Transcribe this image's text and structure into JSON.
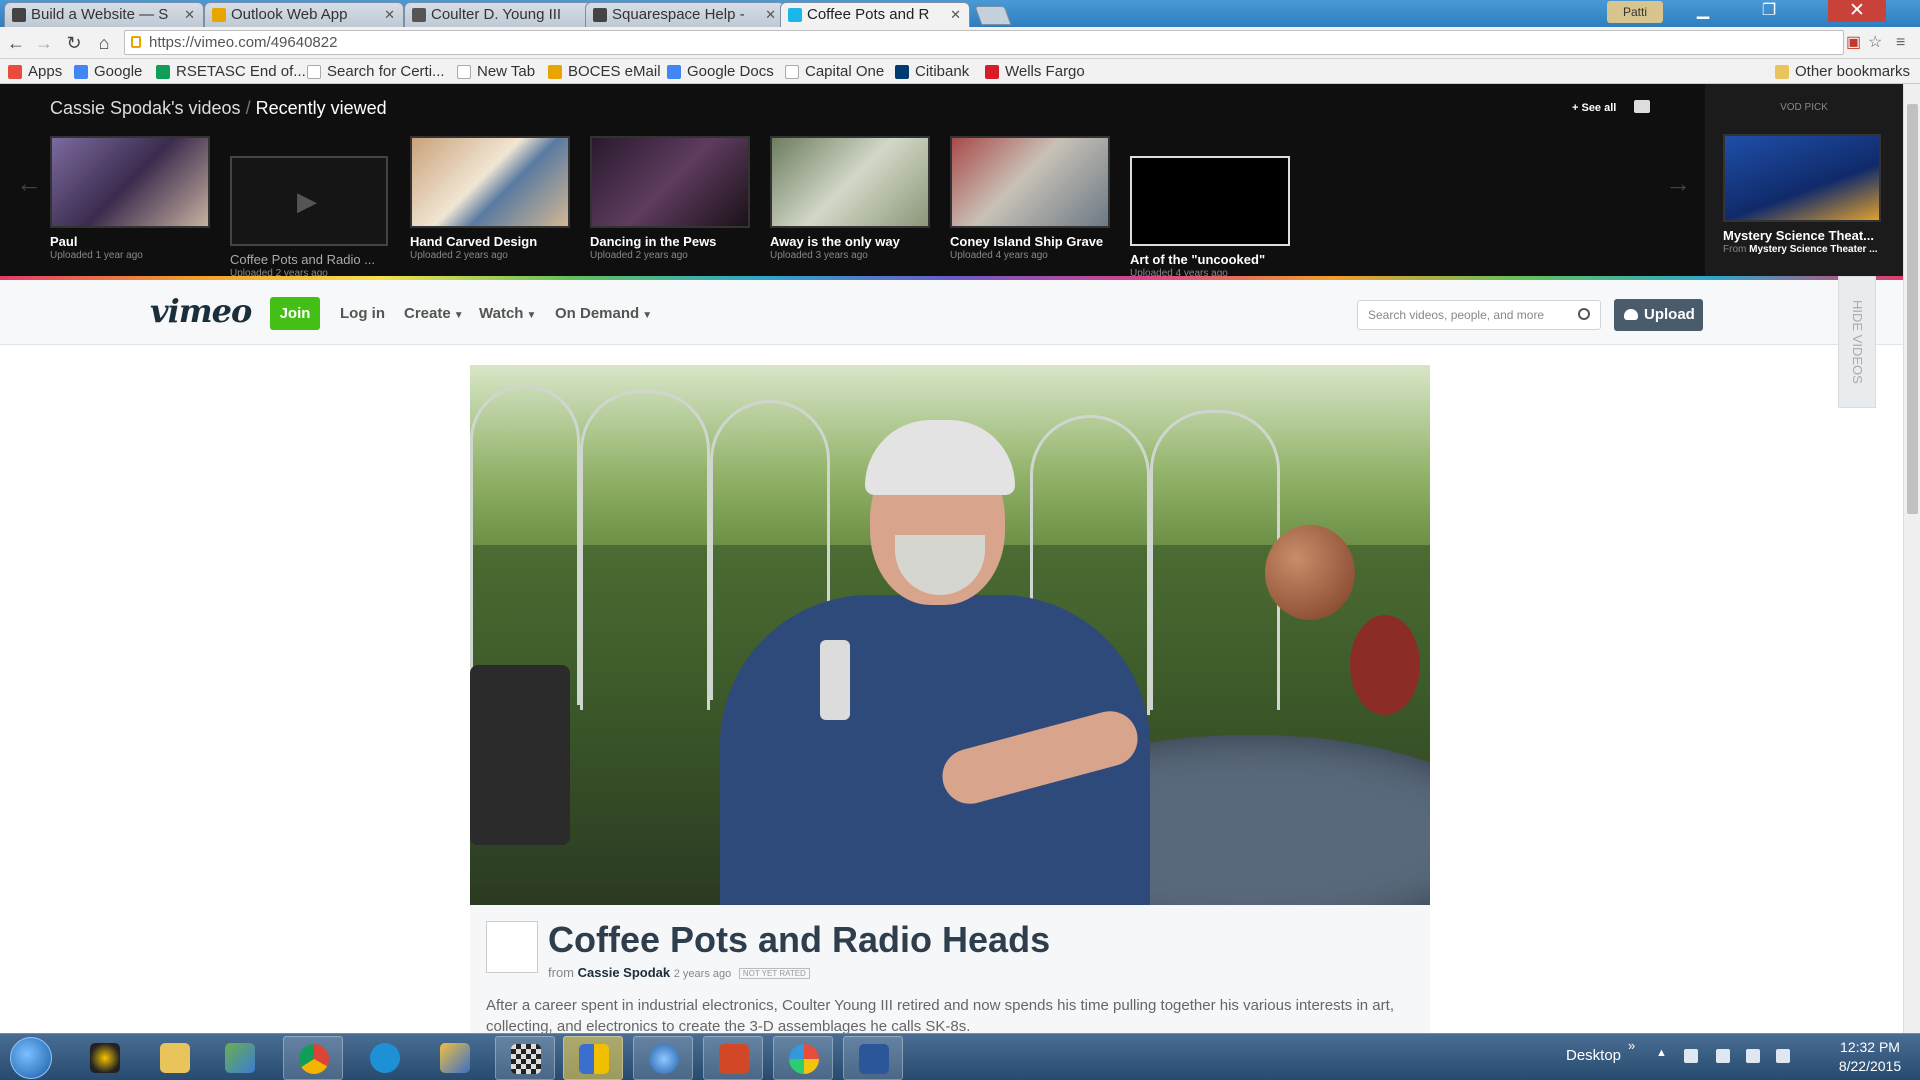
{
  "browser": {
    "tabs": [
      {
        "title": "Build a Website — S",
        "favicon_color": "#444444"
      },
      {
        "title": "Outlook Web App",
        "favicon_color": "#e7a500"
      },
      {
        "title": "Coulter D. Young III",
        "favicon_color": "#555555"
      },
      {
        "title": "Squarespace Help - ",
        "favicon_color": "#444444"
      },
      {
        "title": "Coffee Pots and R",
        "favicon_color": "#1ab7ea",
        "active": true
      }
    ],
    "profile": "Patti",
    "url": "https://vimeo.com/49640822",
    "bookmarks": [
      {
        "label": "Apps",
        "color": "#e84c3d"
      },
      {
        "label": "Google",
        "color": "#4285f4"
      },
      {
        "label": "RSETASC End of...",
        "color": "#0f9d58"
      },
      {
        "label": "Search for Certi...",
        "color": "#ffffff"
      },
      {
        "label": "New Tab",
        "color": "#ffffff"
      },
      {
        "label": "BOCES eMail",
        "color": "#e7a500"
      },
      {
        "label": "Google Docs",
        "color": "#4285f4"
      },
      {
        "label": "Capital One",
        "color": "#ffffff"
      },
      {
        "label": "Citibank",
        "color": "#003b70"
      },
      {
        "label": "Wells Fargo",
        "color": "#d71e28"
      }
    ],
    "other_bookmarks": "Other bookmarks"
  },
  "recently_viewed": {
    "owner": "Cassie Spodak's videos",
    "separator": "/",
    "heading": "Recently viewed",
    "see_all": "+ See all",
    "vod_label": "VOD PICK",
    "items": [
      {
        "title": "Paul",
        "sub": "Uploaded 1 year ago"
      },
      {
        "title": "Coffee Pots and Radio ...",
        "sub": "Uploaded 2 years ago"
      },
      {
        "title": "Hand Carved Design",
        "sub": "Uploaded 2 years ago"
      },
      {
        "title": "Dancing in the Pews",
        "sub": "Uploaded 2 years ago"
      },
      {
        "title": "Away is the only way",
        "sub": "Uploaded 3 years ago"
      },
      {
        "title": "Coney Island Ship Grave",
        "sub": "Uploaded 4 years ago"
      },
      {
        "title": "Art of the \"uncooked\"",
        "sub": "Uploaded 4 years ago"
      }
    ],
    "vod_pick": {
      "title": "Mystery Science Theat...",
      "from_prefix": "From",
      "from": "Mystery Science Theater ..."
    }
  },
  "vimeo": {
    "logo": "vimeo",
    "join": "Join",
    "nav": [
      {
        "label": "Log in",
        "dropdown": false
      },
      {
        "label": "Create",
        "dropdown": true
      },
      {
        "label": "Watch",
        "dropdown": true
      },
      {
        "label": "On Demand",
        "dropdown": true
      }
    ],
    "search_placeholder": "Search videos, people, and more",
    "upload": "Upload",
    "hide_videos": "HIDE VIDEOS",
    "accent": "#44bf15"
  },
  "video": {
    "title": "Coffee Pots and Radio Heads",
    "from": "from",
    "author": "Cassie Spodak",
    "ago": "2 years ago",
    "rating": "NOT YET RATED",
    "description": "After a career spent in industrial electronics, Coulter Young III retired and now spends his time pulling together his various interests in art, collecting, and electronics to create the 3-D assemblages he calls SK-8s."
  },
  "taskbar": {
    "desktop": "Desktop",
    "chevron": "»",
    "time": "12:32 PM",
    "date": "8/22/2015"
  }
}
